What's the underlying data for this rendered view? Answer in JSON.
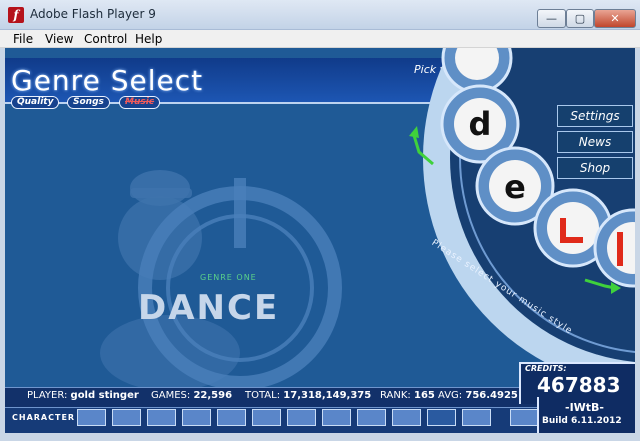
{
  "window": {
    "title": "Adobe Flash Player 9",
    "icon": "flash-icon",
    "controls": {
      "minimize": "—",
      "maximize": "▢",
      "close": "✕"
    }
  },
  "menu": [
    "File",
    "View",
    "Control",
    "Help"
  ],
  "header": {
    "title": "Genre Select",
    "pick_format": "Pick your Slide Format >",
    "pills": [
      "Quality",
      "Songs",
      "Music"
    ]
  },
  "side_buttons": [
    "Settings",
    "News",
    "Shop"
  ],
  "style_hint": "Please select your music style",
  "genre": {
    "small_label": "GENRE ONE",
    "name": "DANCE"
  },
  "credits": {
    "label": "CREDITS:",
    "value": "467883"
  },
  "version": {
    "name": "-IWtB-",
    "build": "Build 6.11.2012"
  },
  "stats": {
    "player_label": "PLAYER:",
    "player": "gold stinger",
    "games_label": "GAMES:",
    "games": "22,596",
    "total_label": "TOTAL:",
    "total": "17,318,149,375",
    "rank_label": "RANK:",
    "rank": "165",
    "avg_label": "AVG:",
    "avg": "756.4925"
  },
  "character_label": "CHARACTER",
  "colors": {
    "stage": "#1f5a96",
    "header": "#103b8a",
    "wheel_accent_red": "#e02a1a",
    "arrow_green": "#3fd13c"
  }
}
